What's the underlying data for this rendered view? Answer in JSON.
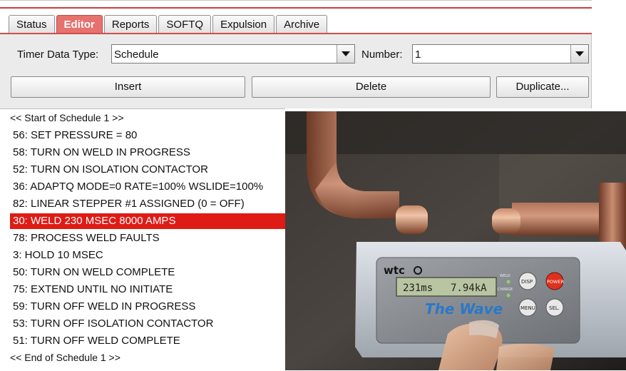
{
  "tabs": [
    {
      "label": "Status",
      "active": false
    },
    {
      "label": "Editor",
      "active": true
    },
    {
      "label": "Reports",
      "active": false
    },
    {
      "label": "SOFTQ",
      "active": false
    },
    {
      "label": "Expulsion",
      "active": false
    },
    {
      "label": "Archive",
      "active": false
    }
  ],
  "controls": {
    "timer_type_label": "Timer Data Type:",
    "timer_type_value": "Schedule",
    "number_label": "Number:",
    "number_value": "1"
  },
  "buttons": {
    "insert": "Insert",
    "delete": "Delete",
    "duplicate": "Duplicate..."
  },
  "schedule": {
    "start_marker": "<< Start of Schedule 1 >>",
    "end_marker": "<< End of Schedule 1 >>",
    "selected_index": 5,
    "items": [
      "56: SET PRESSURE = 80",
      "58: TURN ON WELD IN PROGRESS",
      "52: TURN ON ISOLATION CONTACTOR",
      "36: ADAPTQ MODE=0 RATE=100% WSLIDE=100%",
      "82: LINEAR STEPPER #1 ASSIGNED (0 = OFF)",
      "30: WELD 230 MSEC 8000 AMPS",
      "78: PROCESS WELD FAULTS",
      "3: HOLD 10 MSEC",
      "50: TURN ON WELD COMPLETE",
      "75: EXTEND UNTIL NO INITIATE",
      "59: TURN OFF WELD IN PROGRESS",
      "53: TURN OFF ISOLATION CONTACTOR",
      "51: TURN OFF WELD COMPLETE"
    ]
  },
  "photo": {
    "brand": "wtc",
    "product": "The Wave",
    "lcd_time": "231ms",
    "lcd_current": "7.94kA",
    "led_labels": [
      "WELD",
      "CHARGE"
    ],
    "keys": [
      "DISP",
      "POWER",
      "MENU",
      "SEL."
    ]
  }
}
